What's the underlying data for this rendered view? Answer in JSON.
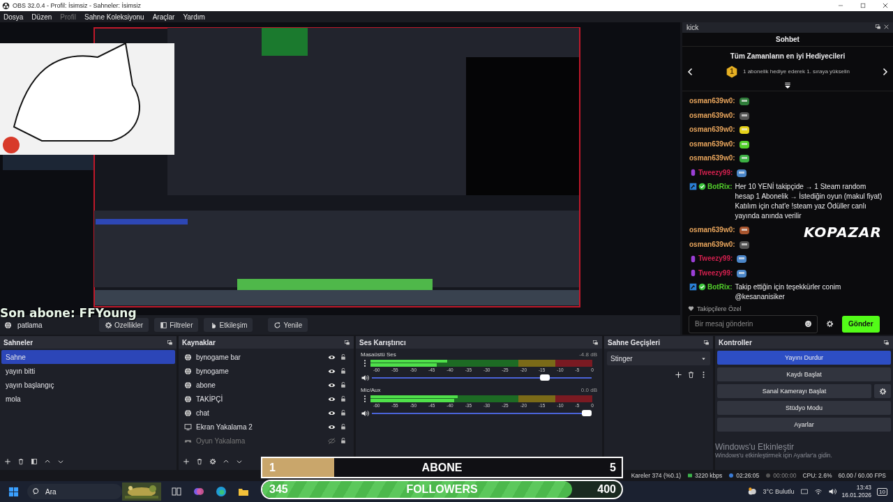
{
  "window": {
    "title": "OBS 32.0.4 - Profil: İsimsiz - Sahneler: İsimsiz"
  },
  "menu": [
    {
      "label": "Dosya",
      "disabled": false
    },
    {
      "label": "Düzen",
      "disabled": false
    },
    {
      "label": "Profil",
      "disabled": true
    },
    {
      "label": "Sahne Koleksiyonu",
      "disabled": false
    },
    {
      "label": "Araçlar",
      "disabled": false
    },
    {
      "label": "Yardım",
      "disabled": false
    }
  ],
  "overlay_text": "Son abone: FFYoung",
  "context_bar": {
    "source": "patlama",
    "buttons": [
      {
        "label": "Ozellikler",
        "kind": "gear"
      },
      {
        "label": "Filtreler",
        "kind": "filter"
      },
      {
        "label": "Etkileşim",
        "kind": "hand"
      },
      {
        "label": "Yenile",
        "kind": "refresh"
      }
    ]
  },
  "chat": {
    "dock_title": "kick",
    "title": "Sohbet",
    "gifters_title": "Tüm Zamanların en iyi Hediyecileri",
    "rank": "1",
    "gifters_text": "1 abonelik hediye ederek 1. sıraya yükselin",
    "messages": [
      {
        "user": "osman639w0:",
        "color": "#e8a55c",
        "mic_badge": false,
        "bot_badge": false,
        "kind": "emote"
      },
      {
        "user": "osman639w0:",
        "color": "#e8a55c",
        "mic_badge": false,
        "bot_badge": false,
        "kind": "emote"
      },
      {
        "user": "osman639w0:",
        "color": "#e8a55c",
        "mic_badge": false,
        "bot_badge": false,
        "kind": "emote"
      },
      {
        "user": "osman639w0:",
        "color": "#e8a55c",
        "mic_badge": false,
        "bot_badge": false,
        "kind": "emote"
      },
      {
        "user": "osman639w0:",
        "color": "#e8a55c",
        "mic_badge": false,
        "bot_badge": false,
        "kind": "emote"
      },
      {
        "user": "Tweezy99:",
        "color": "#d1204e",
        "mic_badge": true,
        "bot_badge": false,
        "kind": "emote"
      },
      {
        "user": "BotRix:",
        "color": "#53d12c",
        "mic_badge": false,
        "bot_badge": true,
        "kind": "text",
        "text": "Her 10 YENİ takipçide → 1 Steam random hesap 1 Abonelik → İstediğin oyun (makul fiyat) Katılım için chat'e !steam yaz Ödüller canlı yayında anında verilir"
      },
      {
        "user": "osman639w0:",
        "color": "#e8a55c",
        "mic_badge": false,
        "bot_badge": false,
        "kind": "emote"
      },
      {
        "user": "osman639w0:",
        "color": "#e8a55c",
        "mic_badge": false,
        "bot_badge": false,
        "kind": "emote"
      },
      {
        "user": "Tweezy99:",
        "color": "#d1204e",
        "mic_badge": true,
        "bot_badge": false,
        "kind": "emote"
      },
      {
        "user": "Tweezy99:",
        "color": "#d1204e",
        "mic_badge": true,
        "bot_badge": false,
        "kind": "emote"
      },
      {
        "user": "BotRix:",
        "color": "#53d12c",
        "mic_badge": false,
        "bot_badge": true,
        "kind": "text",
        "text": "Takip ettiğin için teşekkürler conim @kesananisiker"
      }
    ],
    "sponsor_logo": "KOPAZAR",
    "followers_only": "Takipçilere Özel",
    "input": {
      "placeholder": "Bir mesaj gönderin"
    },
    "send": "Gönder"
  },
  "scenes": {
    "title": "Sahneler",
    "items": [
      {
        "label": "Sahne",
        "selected": true
      },
      {
        "label": "yayın bitti",
        "selected": false
      },
      {
        "label": "yayın başlangıç",
        "selected": false
      },
      {
        "label": "mola",
        "selected": false
      }
    ]
  },
  "sources": {
    "title": "Kaynaklar",
    "items": [
      {
        "label": "bynogame bar",
        "kind": "browser",
        "visible": true
      },
      {
        "label": "bynogame",
        "kind": "browser",
        "visible": true
      },
      {
        "label": "abone",
        "kind": "browser",
        "visible": true
      },
      {
        "label": "TAKİPÇİ",
        "kind": "browser",
        "visible": true
      },
      {
        "label": "chat",
        "kind": "browser",
        "visible": true
      },
      {
        "label": "Ekran Yakalama 2",
        "kind": "display",
        "visible": true
      },
      {
        "label": "Oyun Yakalama",
        "kind": "game",
        "visible": false
      }
    ]
  },
  "mixer": {
    "title": "Ses Karıştırıcı",
    "channels": [
      {
        "name": "Masaüstü Ses",
        "reading": "-4.8 dB",
        "level": 0.8,
        "ticks": [
          "-60",
          "-55",
          "-50",
          "-45",
          "-40",
          "-35",
          "-30",
          "-25",
          "-20",
          "-15",
          "-10",
          "-5",
          "0"
        ]
      },
      {
        "name": "Mic/Aux",
        "reading": "0.0 dB",
        "level": 1,
        "ticks": [
          "-60",
          "-55",
          "-50",
          "-45",
          "-40",
          "-35",
          "-30",
          "-25",
          "-20",
          "-15",
          "-10",
          "-5",
          "0"
        ]
      }
    ]
  },
  "transitions": {
    "title": "Sahne Geçişleri",
    "value": "Stinger"
  },
  "controls": {
    "title": "Kontroller",
    "buttons": [
      {
        "label": "Yayını Durdur",
        "active": true,
        "settings": false
      },
      {
        "label": "Kaydı Başlat",
        "active": false,
        "settings": false
      },
      {
        "label": "Sanal Kamerayı Başlat",
        "active": false,
        "settings": true
      },
      {
        "label": "Stüdyo Modu",
        "active": false,
        "settings": false
      },
      {
        "label": "Ayarlar",
        "active": false,
        "settings": false
      }
    ]
  },
  "activation": {
    "title": "Windows'u Etkinleştir",
    "text": "Windows'u etkinleştirmek için Ayarlar'a gidin."
  },
  "status_bar": {
    "dropped": "Kareler 374 (%0.1)",
    "bitrate": "3220 kbps",
    "stream_time": "02:26:05",
    "record_time": "00:00:00",
    "cpu": "CPU: 2.6%",
    "fps": "60.00 / 60.00 FPS"
  },
  "taskbar": {
    "search": {
      "placeholder": "Ara"
    },
    "weather": "3°C Bulutlu",
    "time": "13:43",
    "date": "16.01.2026",
    "notifications": "10"
  },
  "sub_overlay": {
    "current": "1",
    "label": "ABONE",
    "goal": "5",
    "level": 0.2,
    "followers": {
      "current": "345",
      "label": "FOLLOWERS",
      "goal": "400",
      "level": 0.8625
    }
  }
}
